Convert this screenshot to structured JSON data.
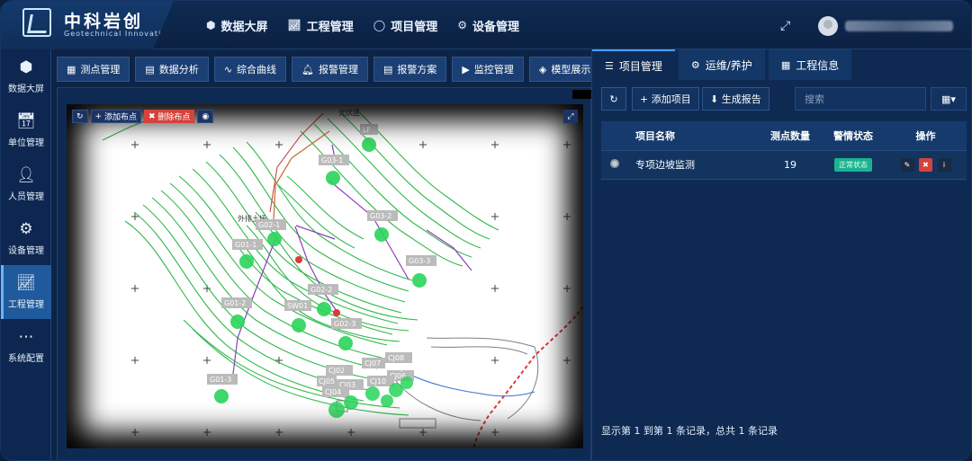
{
  "app": {
    "logo_cn": "中科岩创",
    "logo_en": "Geotechnical Innovation"
  },
  "topnav": [
    {
      "label": "数据大屏",
      "icon": "cube-icon"
    },
    {
      "label": "工程管理",
      "icon": "chart-icon"
    },
    {
      "label": "项目管理",
      "icon": "circle-icon"
    },
    {
      "label": "设备管理",
      "icon": "gear-icon"
    }
  ],
  "sidebar": [
    {
      "label": "数据大屏",
      "icon": "cube-icon"
    },
    {
      "label": "单位管理",
      "icon": "calendar-icon"
    },
    {
      "label": "人员管理",
      "icon": "user-card-icon"
    },
    {
      "label": "设备管理",
      "icon": "gear-icon"
    },
    {
      "label": "工程管理",
      "icon": "chart-line-icon",
      "active": true
    },
    {
      "label": "系统配置",
      "icon": "dots-icon"
    }
  ],
  "toolbar": [
    {
      "label": "测点管理",
      "icon": "cubes-icon"
    },
    {
      "label": "数据分析",
      "icon": "bar-chart-icon"
    },
    {
      "label": "综合曲线",
      "icon": "line-chart-icon"
    },
    {
      "label": "报警管理",
      "icon": "bell-icon"
    },
    {
      "label": "报警方案",
      "icon": "book-icon"
    },
    {
      "label": "监控管理",
      "icon": "camera-icon"
    },
    {
      "label": "模型展示",
      "icon": "cube-outline-icon"
    }
  ],
  "map": {
    "add_point": "添加布点",
    "delete_point": "删除布点",
    "labels": {
      "north": "光伏区",
      "west": "外排土场"
    },
    "points": [
      "LF",
      "G03-1",
      "G02-1",
      "G01-1",
      "G03-2",
      "G03-3",
      "G02-2",
      "G01-2",
      "SW01",
      "G02-3",
      "G01-3",
      "CJ08",
      "CJ07",
      "CJ02",
      "CJ06",
      "CJ05",
      "CJ09",
      "CJ03",
      "CJ04",
      "CJ10"
    ]
  },
  "right_panel": {
    "tabs": [
      {
        "label": "项目管理",
        "icon": "list-icon",
        "active": true
      },
      {
        "label": "运维/养护",
        "icon": "cogs-icon"
      },
      {
        "label": "工程信息",
        "icon": "cubes-icon"
      }
    ],
    "add_project": "添加项目",
    "generate_report": "生成报告",
    "search_placeholder": "搜索",
    "table": {
      "headers": [
        "项目名称",
        "测点数量",
        "警情状态",
        "操作"
      ],
      "rows": [
        {
          "name": "专项边坡监测",
          "points": "19",
          "status": "正常状态"
        }
      ]
    },
    "footer": "显示第 1 到第 1 条记录，总共 1 条记录"
  }
}
